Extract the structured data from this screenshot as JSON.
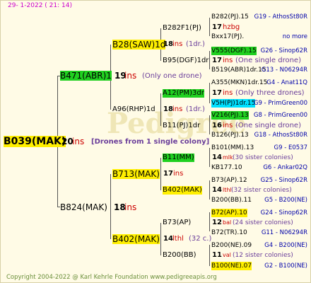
{
  "header": {
    "left": "29-  1-2022 (  21:  14)"
  },
  "footer": {
    "copyright": "Copyright 2004-2022 @ Karl Kehrle Foundation    www.pedigreeapis.org"
  },
  "root": {
    "name": "B039(MAK)",
    "num": "20",
    "ins": "ins",
    "note": "[Drones from 1 single colony]"
  },
  "gen1": {
    "father": {
      "name": "B471(ABR)1",
      "num": "19",
      "ins": "ins",
      "note": "(Only one drone)"
    },
    "mother": {
      "name": "B824(MAK)",
      "num": "18",
      "ins": "ins"
    }
  },
  "gen2": {
    "ff": {
      "name": "B28(SAW)1d",
      "num": "18",
      "ins": "ins",
      "note": "(1dr.)"
    },
    "fm": {
      "name": "A96(RHP)1d",
      "num": "18",
      "ins": "ins",
      "note": "(1dr.)"
    },
    "mf": {
      "name": "B713(MAK)",
      "num": "17",
      "ins": "ins"
    },
    "mm": {
      "name": "B402(MAK)",
      "num": "14",
      "ins": "lthl",
      "note": "(32 c.)"
    }
  },
  "gen3": {
    "fff": {
      "name": "B282F1(PJ)",
      "num": "17",
      "ins": "hzbg"
    },
    "ffm": {
      "name": "B95(DGF)1dr",
      "num": "17",
      "ins": "ins",
      "note": "(One single drone)"
    },
    "fmf": {
      "name": "A12(PM)3dr",
      "num": "17",
      "ins": "ins",
      "note": "(Only three drones)"
    },
    "fmm": {
      "name": "B11(PJ)1dr",
      "num": "16",
      "ins": "ins",
      "note": "(One single drone)"
    },
    "mff": {
      "name": "B11(MM)",
      "num": "14",
      "ins": "mlk",
      "note": "(30 sister colonies)"
    },
    "mfm": {
      "name": "B402(MAK)",
      "num": "14",
      "ins": "lthl",
      "note": "(32 sister colonies)"
    },
    "mmf": {
      "name": "B73(AP)",
      "num": "12",
      "ins": "bal",
      "note": "(24 sister colonies)"
    },
    "mmm": {
      "name": "B200(BB)",
      "num": "11",
      "ins": "val",
      "note": "(12 sister colonies)"
    }
  },
  "gen4": [
    {
      "name": "B282(PJ).15",
      "ref": "G19 - AthosSt80R"
    },
    {
      "name": "Bxx17(PJ).",
      "ref": "no more"
    },
    {
      "name": "V555(DGF).15",
      "ref": "G26 - Sinop62R"
    },
    {
      "name": "B519(ABR)1dr.15",
      "ref": "G13 - N06294R"
    },
    {
      "name": "A355(MKN)1dr.15",
      "ref": "G4 - Anat11Q"
    },
    {
      "name": "V5H(PJ)1dr.15",
      "ref": "G9 - PrimGreen00"
    },
    {
      "name": "V216(PJ).13",
      "ref": "G8 - PrimGreen00"
    },
    {
      "name": "B126(PJ).13",
      "ref": "G18 - AthosSt80R"
    },
    {
      "name": "B101(MM).13",
      "ref": "G9 - E0537"
    },
    {
      "name": "KB177.10",
      "ref": "G6 - Ankar02Q"
    },
    {
      "name": "B73(AP).12",
      "ref": "G25 - Sinop62R"
    },
    {
      "name": "B200(BB).11",
      "ref": "G5 - B200(NE)"
    },
    {
      "name": "B72(AP).10",
      "ref": "G24 - Sinop62R"
    },
    {
      "name": "B72(TR).10",
      "ref": "G11 - N06294R"
    },
    {
      "name": "B200(NE).09",
      "ref": "G4 - B200(NE)"
    },
    {
      "name": "B100(NE).07",
      "ref": "G2 - B100(NE)"
    }
  ],
  "watermark": "Pedigree",
  "colors": {
    "yellow": "#ffef00",
    "green": "#20d020",
    "cyan": "#00e0ff",
    "red": "#cc0000",
    "blue": "#0000aa",
    "background": "#fffbe6"
  }
}
